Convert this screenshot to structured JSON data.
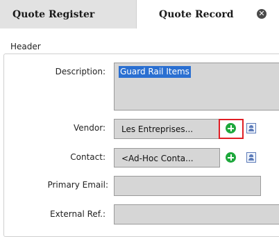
{
  "tabs": [
    {
      "label": "Quote Register"
    },
    {
      "label": "Quote Record",
      "close_glyph": "✕"
    }
  ],
  "header_group": {
    "legend": "Header"
  },
  "form": {
    "description": {
      "label": "Description:",
      "value": "Guard Rail Items"
    },
    "vendor": {
      "label": "Vendor:",
      "value": "Les Entreprises...",
      "add_icon": "add-circle-icon",
      "lookup_icon": "contact-card-icon"
    },
    "contact": {
      "label": "Contact:",
      "value": "<Ad-Hoc Conta...",
      "add_icon": "add-circle-icon",
      "lookup_icon": "contact-card-icon"
    },
    "primary_email": {
      "label": "Primary Email:",
      "value": ""
    },
    "external_ref": {
      "label": "External Ref.:",
      "value": ""
    }
  },
  "colors": {
    "selection": "#2a6fd1",
    "add_icon": "#1ea83c",
    "highlight": "#e01e24",
    "field_bg": "#d6d6d6"
  }
}
